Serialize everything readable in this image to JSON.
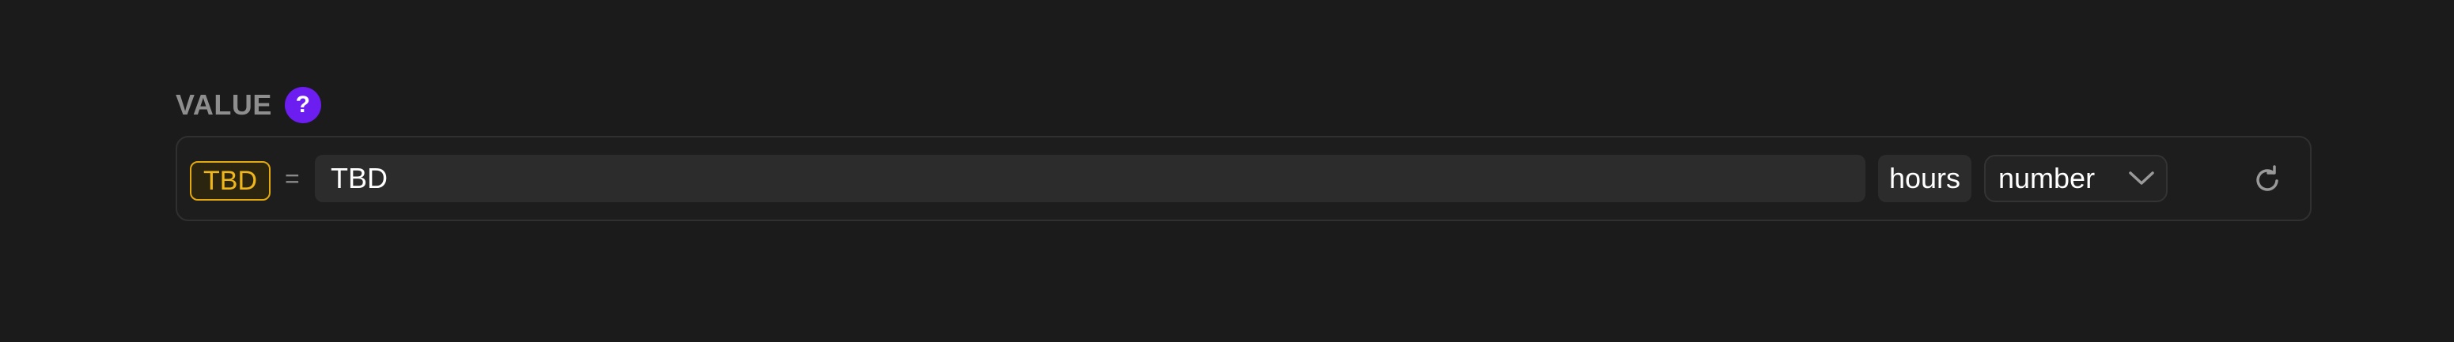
{
  "field": {
    "label": "VALUE",
    "help_symbol": "?",
    "token": "TBD",
    "operator": "=",
    "value": "TBD",
    "unit": "hours",
    "type": "number",
    "icons": {
      "help": "question-circle-icon",
      "dropdown": "chevron-down-icon",
      "reset": "refresh-icon"
    }
  },
  "colors": {
    "background": "#1b1b1b",
    "accent_purple": "#6c1df0",
    "token_yellow": "#f0b71a"
  }
}
